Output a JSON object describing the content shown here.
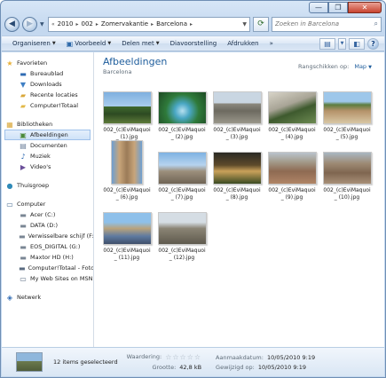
{
  "window": {
    "minimize": "—",
    "maximize": "❐",
    "close": "✕"
  },
  "address_bar": {
    "back_icon": "back-arrow-icon",
    "forward_icon": "forward-arrow-icon",
    "crumbs": [
      "2010",
      "002",
      "Zomervakantie",
      "Barcelona"
    ],
    "search_placeholder": "Zoeken in Barcelona"
  },
  "toolbar": {
    "organize": "Organiseren",
    "preview": "Voorbeeld",
    "share": "Delen met",
    "slideshow": "Diavoorstelling",
    "print": "Afdrukken",
    "more": "»"
  },
  "sidebar": {
    "favorites": {
      "header": "Favorieten",
      "items": [
        "Bureaublad",
        "Downloads",
        "Recente locaties",
        "Computer!Totaal"
      ]
    },
    "libraries": {
      "header": "Bibliotheken",
      "items": [
        "Afbeeldingen",
        "Documenten",
        "Muziek",
        "Video's"
      ],
      "selected": "Afbeeldingen"
    },
    "homegroup": {
      "header": "Thuisgroep"
    },
    "computer": {
      "header": "Computer",
      "items": [
        "Acer (C:)",
        "DATA (D:)",
        "Verwisselbare schijf (F:)",
        "EOS_DIGITAL (G:)",
        "Maxtor HD (H:)",
        "Computer!Totaal - Foto",
        "My Web Sites on MSN"
      ]
    },
    "network": {
      "header": "Netwerk"
    }
  },
  "library": {
    "title": "Afbeeldingen",
    "subtitle": "Barcelona",
    "arrange_label": "Rangschikken op:",
    "arrange_value": "Map"
  },
  "files": [
    {
      "line1": "002_(c)EviMaquoi",
      "line2": "_ (1).jpg"
    },
    {
      "line1": "002_(c)EviMaquoi",
      "line2": "_ (2).jpg"
    },
    {
      "line1": "002_(c)EviMaquoi",
      "line2": "_ (3).jpg"
    },
    {
      "line1": "002_(c)EviMaquoi",
      "line2": "_ (4).jpg"
    },
    {
      "line1": "002_(c)EviMaquoi",
      "line2": "_ (5).jpg"
    },
    {
      "line1": "002_(c)EviMaquoi",
      "line2": "_ (6).jpg"
    },
    {
      "line1": "002_(c)EviMaquoi",
      "line2": "_ (7).jpg"
    },
    {
      "line1": "002_(c)EviMaquoi",
      "line2": "_ (8).jpg"
    },
    {
      "line1": "002_(c)EviMaquoi",
      "line2": "_ (9).jpg"
    },
    {
      "line1": "002_(c)EviMaquoi",
      "line2": "_ (10).jpg"
    },
    {
      "line1": "002_(c)EviMaquoi",
      "line2": "_ (11).jpg"
    },
    {
      "line1": "002_(c)EviMaquoi",
      "line2": "_ (12).jpg"
    }
  ],
  "details": {
    "selection": "12 items geselecteerd",
    "rating_label": "Waardering:",
    "size_label": "Grootte:",
    "size_value": "42,8 kB",
    "created_label": "Aanmaakdatum:",
    "created_value": "10/05/2010 9:19",
    "modified_label": "Gewijzigd op:",
    "modified_value": "10/05/2010 9:19"
  },
  "colors": {
    "accent": "#1e5d9c",
    "selection_bg": "#cfe2f8"
  }
}
